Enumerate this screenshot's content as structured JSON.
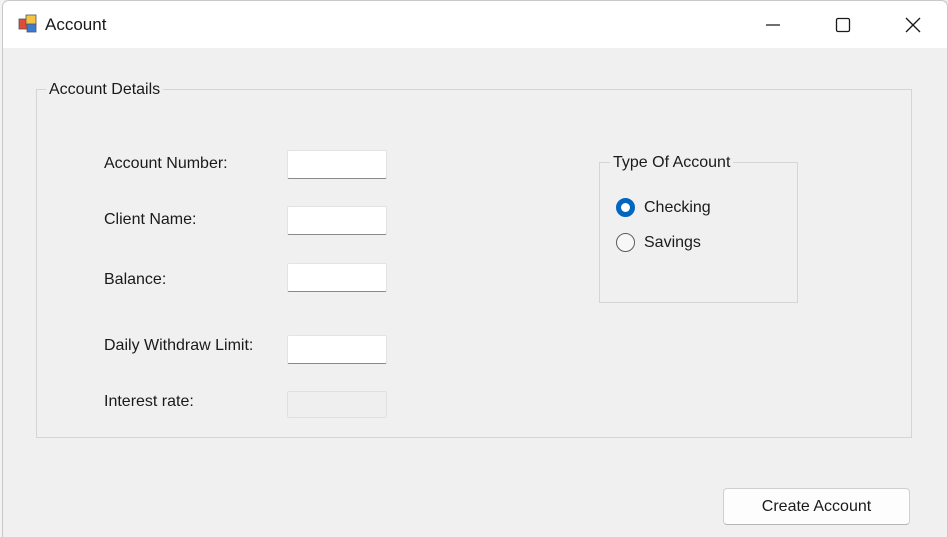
{
  "window": {
    "title": "Account",
    "controls": {
      "minimize": "minimize-icon",
      "maximize": "maximize-icon",
      "close": "close-icon"
    }
  },
  "account_details": {
    "legend": "Account Details",
    "fields": {
      "account_number": {
        "label": "Account Number:",
        "value": ""
      },
      "client_name": {
        "label": "Client Name:",
        "value": ""
      },
      "balance": {
        "label": "Balance:",
        "value": ""
      },
      "daily_withdraw_limit": {
        "label": "Daily Withdraw Limit:",
        "value": ""
      },
      "interest_rate": {
        "label": "Interest rate:",
        "value": "",
        "enabled": false
      }
    }
  },
  "type_of_account": {
    "legend": "Type Of Account",
    "options": [
      {
        "label": "Checking",
        "checked": true
      },
      {
        "label": "Savings",
        "checked": false
      }
    ]
  },
  "actions": {
    "create_label": "Create Account"
  },
  "colors": {
    "accent": "#0067c0",
    "window_bg": "#f0f0f0",
    "titlebar_bg": "#ffffff"
  }
}
